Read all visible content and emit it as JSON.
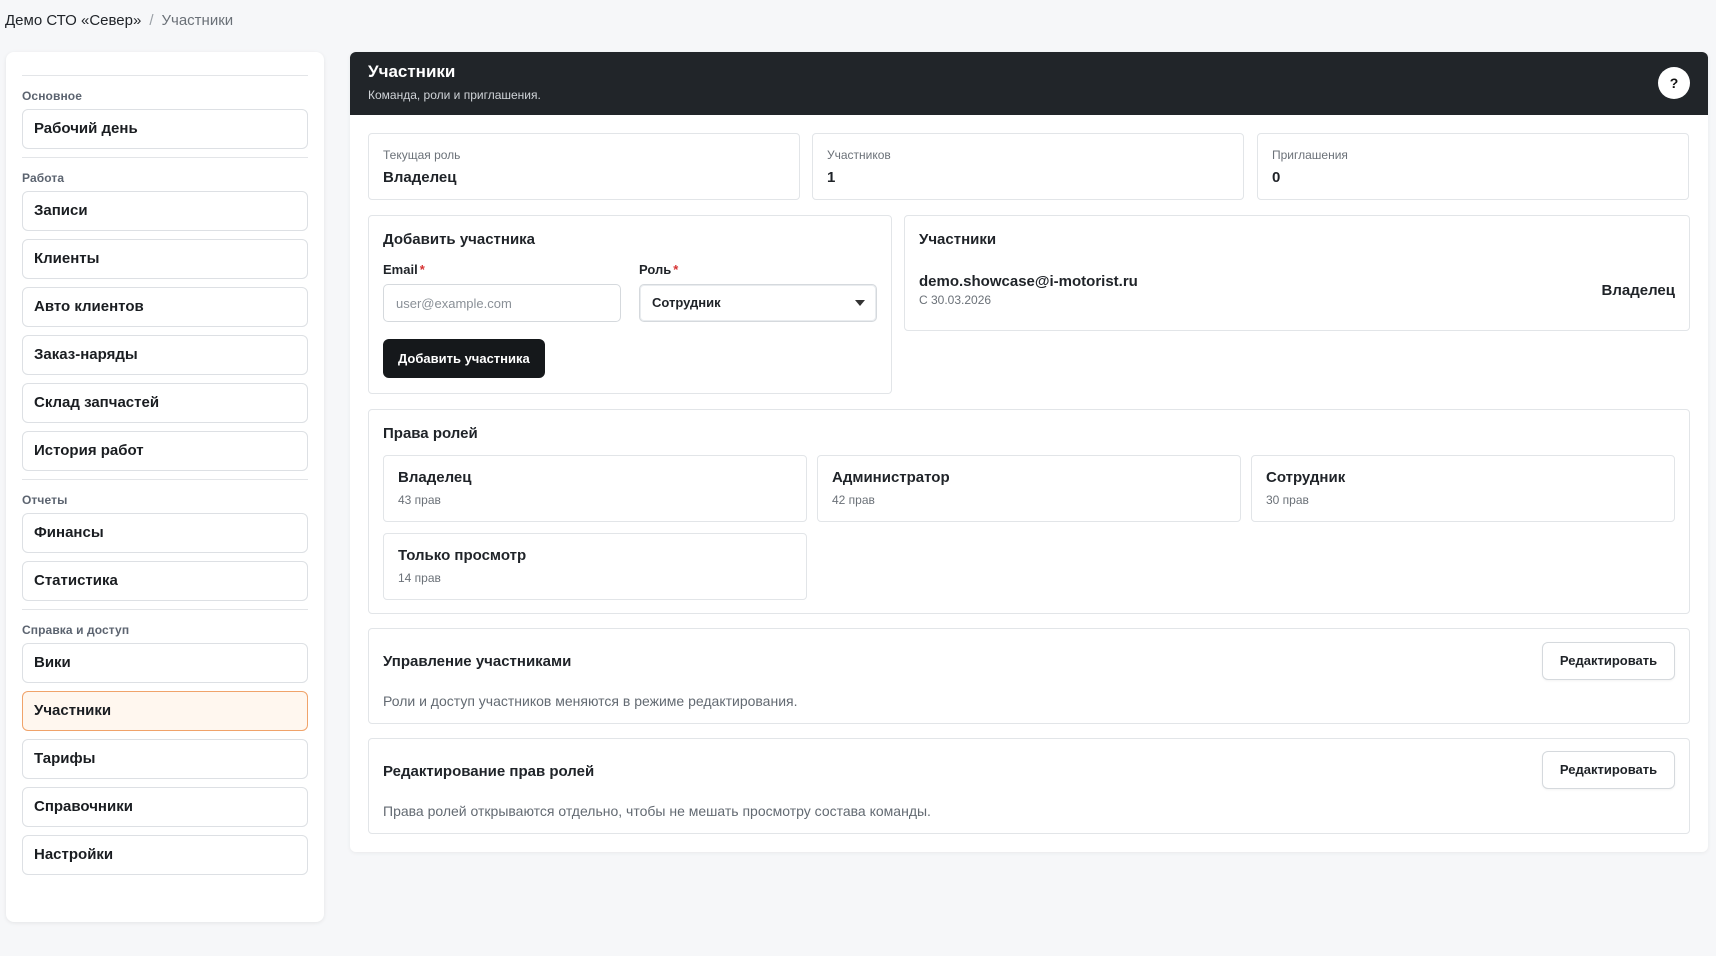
{
  "breadcrumb": {
    "root": "Демо СТО «Север»",
    "separator": "/",
    "current": "Участники"
  },
  "sidebar": {
    "groups": [
      {
        "title": "Основное",
        "items": [
          "Рабочий день"
        ]
      },
      {
        "title": "Работа",
        "items": [
          "Записи",
          "Клиенты",
          "Авто клиентов",
          "Заказ-наряды",
          "Склад запчастей",
          "История работ"
        ]
      },
      {
        "title": "Отчеты",
        "items": [
          "Финансы",
          "Статистика"
        ]
      },
      {
        "title": "Справка и доступ",
        "items": [
          "Вики",
          "Участники",
          "Тарифы",
          "Справочники",
          "Настройки"
        ]
      }
    ],
    "active_item": "Участники"
  },
  "header": {
    "title": "Участники",
    "subtitle": "Команда, роли и приглашения.",
    "help": "?"
  },
  "stats": [
    {
      "label": "Текущая роль",
      "value": "Владелец"
    },
    {
      "label": "Участников",
      "value": "1"
    },
    {
      "label": "Приглашения",
      "value": "0"
    }
  ],
  "add_member": {
    "title": "Добавить участника",
    "email_label": "Email",
    "email_placeholder": "user@example.com",
    "email_value": "",
    "role_label": "Роль",
    "role_value": "Сотрудник",
    "required_mark": "*",
    "submit": "Добавить участника"
  },
  "members": {
    "title": "Участники",
    "list": [
      {
        "email": "demo.showcase@i-motorist.ru",
        "since": "С 30.03.2026",
        "role": "Владелец"
      }
    ]
  },
  "role_rights": {
    "title": "Права ролей",
    "roles": [
      {
        "name": "Владелец",
        "count": "43 прав"
      },
      {
        "name": "Администратор",
        "count": "42 прав"
      },
      {
        "name": "Сотрудник",
        "count": "30 прав"
      },
      {
        "name": "Только просмотр",
        "count": "14 прав"
      }
    ]
  },
  "manage_members": {
    "title": "Управление участниками",
    "button": "Редактировать",
    "description": "Роли и доступ участников меняются в режиме редактирования."
  },
  "edit_rights": {
    "title": "Редактирование прав ролей",
    "button": "Редактировать",
    "description": "Права ролей открываются отдельно, чтобы не мешать просмотру состава команды."
  }
}
